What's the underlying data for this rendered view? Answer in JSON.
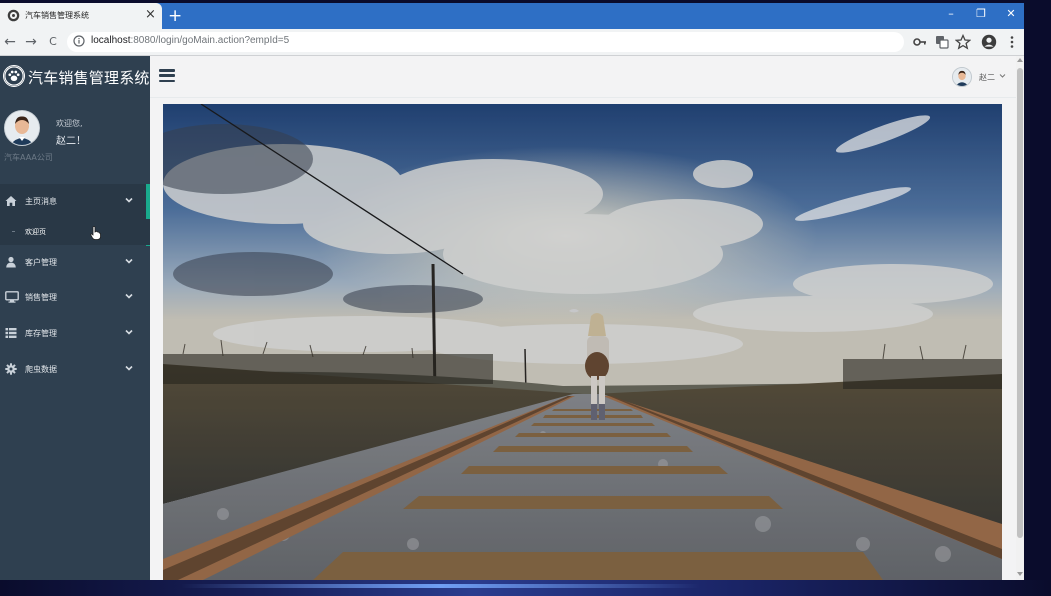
{
  "browser": {
    "tab_title": "汽车销售管理系统",
    "close_tab": "×",
    "new_tab": "+",
    "url_host": "localhost",
    "url_rest": ":8080/login/goMain.action?empId=5",
    "window_controls": {
      "minimize": "–",
      "restore": "❐",
      "close": "✕"
    },
    "nav": {
      "back": "←",
      "forward": "→",
      "reload": "C"
    },
    "icons": [
      "key-icon",
      "translate-icon",
      "star-icon",
      "account-icon",
      "more-icon"
    ]
  },
  "brand": {
    "name": "汽车销售管理系统"
  },
  "profile": {
    "welcome": "欢迎您,",
    "user_name": "赵二！",
    "company": "汽车AAA公司"
  },
  "menu": {
    "home": "主页消息",
    "home_sub": "欢迎页",
    "customers": "客户管理",
    "sales": "销售管理",
    "inventory": "库存管理",
    "crawler": "爬虫数据"
  },
  "header": {
    "user_name": "赵二"
  },
  "colors": {
    "sidebar": "#2f4050",
    "accent": "#19aa8d",
    "tabbar": "#2e6fc5"
  }
}
